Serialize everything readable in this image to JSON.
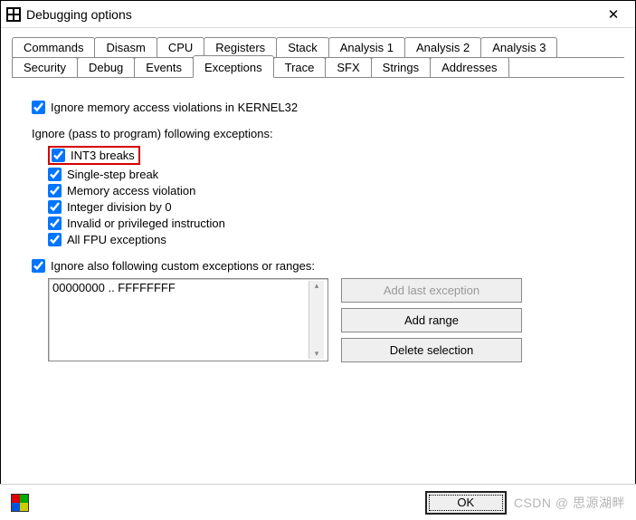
{
  "window": {
    "title": "Debugging options"
  },
  "tabs_row1": [
    {
      "label": "Commands"
    },
    {
      "label": "Disasm"
    },
    {
      "label": "CPU"
    },
    {
      "label": "Registers"
    },
    {
      "label": "Stack"
    },
    {
      "label": "Analysis 1"
    },
    {
      "label": "Analysis 2"
    },
    {
      "label": "Analysis 3"
    }
  ],
  "tabs_row2": [
    {
      "label": "Security"
    },
    {
      "label": "Debug"
    },
    {
      "label": "Events"
    },
    {
      "label": "Exceptions",
      "active": true
    },
    {
      "label": "Trace"
    },
    {
      "label": "SFX"
    },
    {
      "label": "Strings"
    },
    {
      "label": "Addresses"
    }
  ],
  "options": {
    "ignore_kernel32": "Ignore memory access violations in KERNEL32",
    "section_following": "Ignore (pass to program) following exceptions:",
    "int3": "INT3 breaks",
    "singlestep": "Single-step break",
    "memaccess": "Memory access violation",
    "intdiv": "Integer division by 0",
    "invalid": "Invalid or privileged instruction",
    "fpu": "All FPU exceptions",
    "ignore_custom": "Ignore also following custom exceptions or ranges:"
  },
  "custom_list": {
    "item0": "00000000 .. FFFFFFFF"
  },
  "buttons": {
    "add_last": "Add last exception",
    "add_range": "Add range",
    "delete_sel": "Delete selection",
    "ok": "OK"
  },
  "watermark": "CSDN @ 思源湖畔"
}
